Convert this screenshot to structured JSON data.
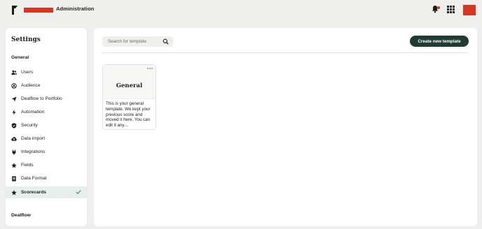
{
  "header": {
    "app_title": "Administration",
    "brand_color": "#d9341f",
    "icons": [
      "logo-icon",
      "bell-icon",
      "apps-grid-icon",
      "avatar"
    ]
  },
  "sidebar": {
    "title": "Settings",
    "section_label": "General",
    "items": [
      {
        "label": "Users",
        "icon": "users-icon"
      },
      {
        "label": "Audience",
        "icon": "audience-icon"
      },
      {
        "label": "Dealflow to Portfolio",
        "icon": "send-icon"
      },
      {
        "label": "Automation",
        "icon": "bolt-icon"
      },
      {
        "label": "Security",
        "icon": "shield-icon"
      },
      {
        "label": "Data import",
        "icon": "cloud-upload-icon"
      },
      {
        "label": "Integrations",
        "icon": "plug-icon"
      },
      {
        "label": "Fields",
        "icon": "star-icon"
      },
      {
        "label": "Data Format",
        "icon": "document-icon"
      },
      {
        "label": "Scorecards",
        "icon": "star-icon",
        "active": true
      }
    ],
    "footer_label": "Dealflow",
    "active_color": "#e6efec",
    "check_color": "#3f8f6a"
  },
  "main": {
    "search": {
      "placeholder": "Search for template"
    },
    "create_button_label": "Create new template",
    "button_color": "#1f3b33",
    "cards": [
      {
        "title": "General",
        "description": "This is your general template. We kept your previous score and moved it here. You can edit it any..."
      }
    ]
  }
}
